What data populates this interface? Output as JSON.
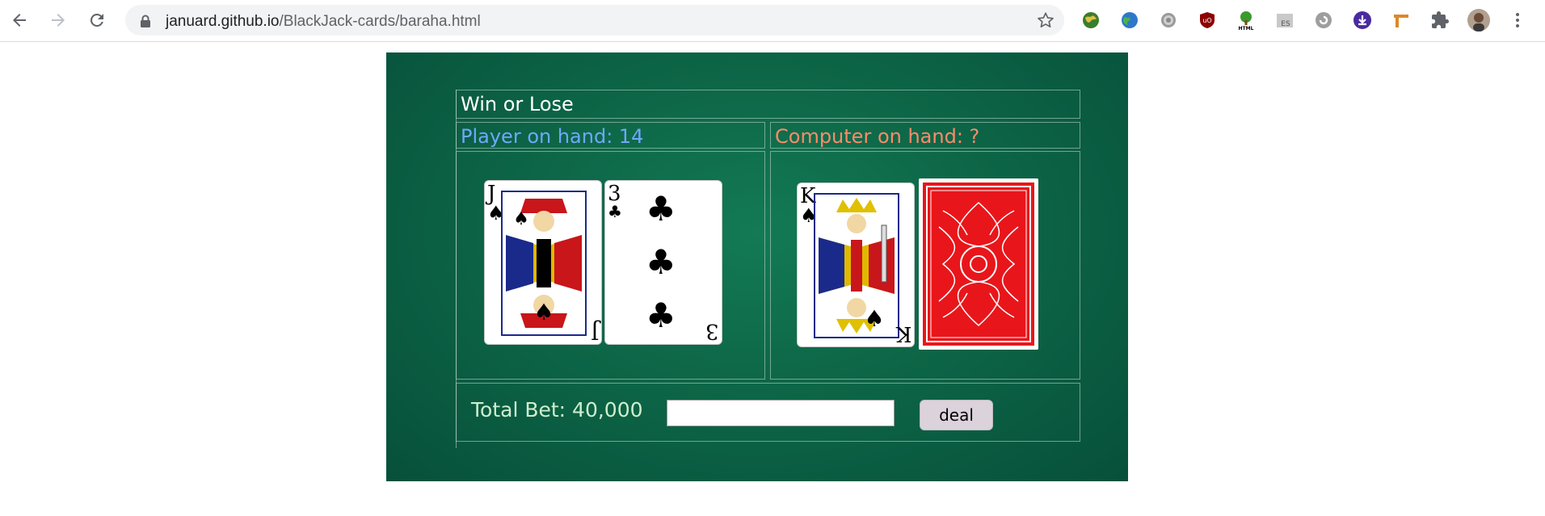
{
  "browser": {
    "url_host": "januard.github.io",
    "url_path": "/BlackJack-cards/baraha.html",
    "extensions": [
      "earth-globe-icon",
      "globe-icon",
      "gear-icon",
      "ublock-icon",
      "html-tree-icon",
      "es-icon",
      "refresh-circle-icon",
      "download-icon",
      "ruler-icon",
      "puzzle-icon",
      "profile-avatar",
      "menu-dots-icon"
    ]
  },
  "game": {
    "title": "Win or Lose",
    "player_label": "Player on hand: 14",
    "computer_label": "Computer on hand: ?",
    "player_cards": [
      {
        "rank": "J",
        "suit": "♠"
      },
      {
        "rank": "3",
        "suit": "♣"
      }
    ],
    "computer_cards": [
      {
        "rank": "K",
        "suit": "♠"
      },
      {
        "rank": "",
        "suit": "",
        "face_down": true
      }
    ],
    "bet_label": "Total Bet: 40,000",
    "bet_input_value": "",
    "deal_label": "deal"
  },
  "colors": {
    "felt": "#0d6647",
    "player_label": "#6fa8ff",
    "computer_label": "#ff8a6a",
    "card_back": "#e8161b"
  }
}
